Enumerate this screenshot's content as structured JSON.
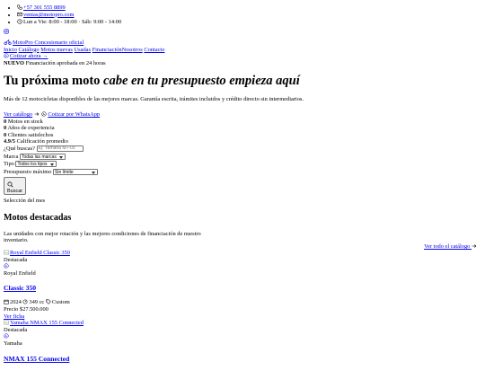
{
  "contacts": {
    "phone": "+57 301 555 8899",
    "email": "ventas@motopro.com",
    "hours": "Lun a Vie: 8:00 - 18:00 · Sáb: 9:00 - 14:00"
  },
  "brand": {
    "name": "MotoPro Concesionario oficial"
  },
  "nav": {
    "items": [
      "Inicio",
      "Catálogo",
      "Motos nuevas",
      "Usadas",
      "Financiación",
      "Nosotros",
      "Contacto"
    ],
    "cta": "Cotizar ahora",
    "cta_arrow": "→"
  },
  "banner": {
    "badge": "NUEVO",
    "text": "Financiación aprobada en 24 horas"
  },
  "hero": {
    "title_start": "Tu próxima moto",
    "title_em": "cabe en tu presupuesto empieza aquí",
    "lead": "Más de 12 motocicletas disponibles de las mejores marcas. Garantía escrita, trámites incluidos y crédito directo sin intermediarios.",
    "catalog_link": "Ver catálogo",
    "whatsapp_link": "Cotizar por WhatsApp"
  },
  "stats": [
    {
      "value": "0",
      "label": "Motos en stock"
    },
    {
      "value": "0",
      "label": "Años de experiencia"
    },
    {
      "value": "0",
      "label": "Clientes satisfechos"
    },
    {
      "value": "4.9/5",
      "label": "Calificación promedio"
    }
  ],
  "search": {
    "query_label": "¿Qué buscas?",
    "query_placeholder": "Ej: Yamaha MT-03",
    "brand_label": "Marca",
    "brand_value": "Todas las marcas",
    "type_label": "Tipo",
    "type_value": "Todos los tipos",
    "budget_label": "Presupuesto máximo",
    "budget_value": "Sin límite",
    "button": "Buscar"
  },
  "featured": {
    "eyebrow": "Selección del mes",
    "title": "Motos destacadas",
    "desc": "Las unidades con mejor rotación y las mejores condiciones de financiación de nuestro inventario.",
    "all_link": "Ver todo el catálogo",
    "cards": [
      {
        "img_alt": "Royal Enfield Classic 350",
        "badge": "Destacada",
        "brand": "Royal Enfield",
        "model": "Classic 350",
        "year": "2024",
        "cc": "349 cc",
        "type": "Custom",
        "price": "Precio $27.500.000",
        "detail_link": "Ver ficha"
      },
      {
        "img_alt": "Yamaha NMAX 155 Connected",
        "badge": "Destacada",
        "brand": "Yamaha",
        "model": "NMAX 155 Connected"
      }
    ]
  }
}
